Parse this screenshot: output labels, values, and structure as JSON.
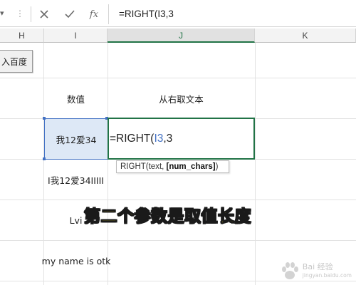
{
  "formula_bar": {
    "dots": "⋮",
    "cancel_label": "✕",
    "enter_label": "✓",
    "fx_label": "fx",
    "formula": "=RIGHT(I3,3"
  },
  "columns": [
    {
      "id": "H"
    },
    {
      "id": "I"
    },
    {
      "id": "J"
    },
    {
      "id": "K"
    }
  ],
  "button": {
    "label": "入百度"
  },
  "cells": {
    "i_header": "数值",
    "j_header": "从右取文本",
    "i3": "我12爱34",
    "i4": "I我12爱34IIIII",
    "i5": "Lvi",
    "i6": "my name is otk"
  },
  "edit": {
    "prefix": "=RIGHT(",
    "ref": "I3",
    "suffix": ",3"
  },
  "tooltip": {
    "func": "RIGHT(",
    "arg1": "text, ",
    "arg2": "[num_chars]",
    "close": ")"
  },
  "caption": "第二个参数是取值长度",
  "watermark": {
    "main": "Bai 经验",
    "sub": "jingyan.baidu.com"
  },
  "colors": {
    "selection_green": "#217346",
    "ref_blue": "#4472c4",
    "caption_yellow": "#ffef1a"
  }
}
